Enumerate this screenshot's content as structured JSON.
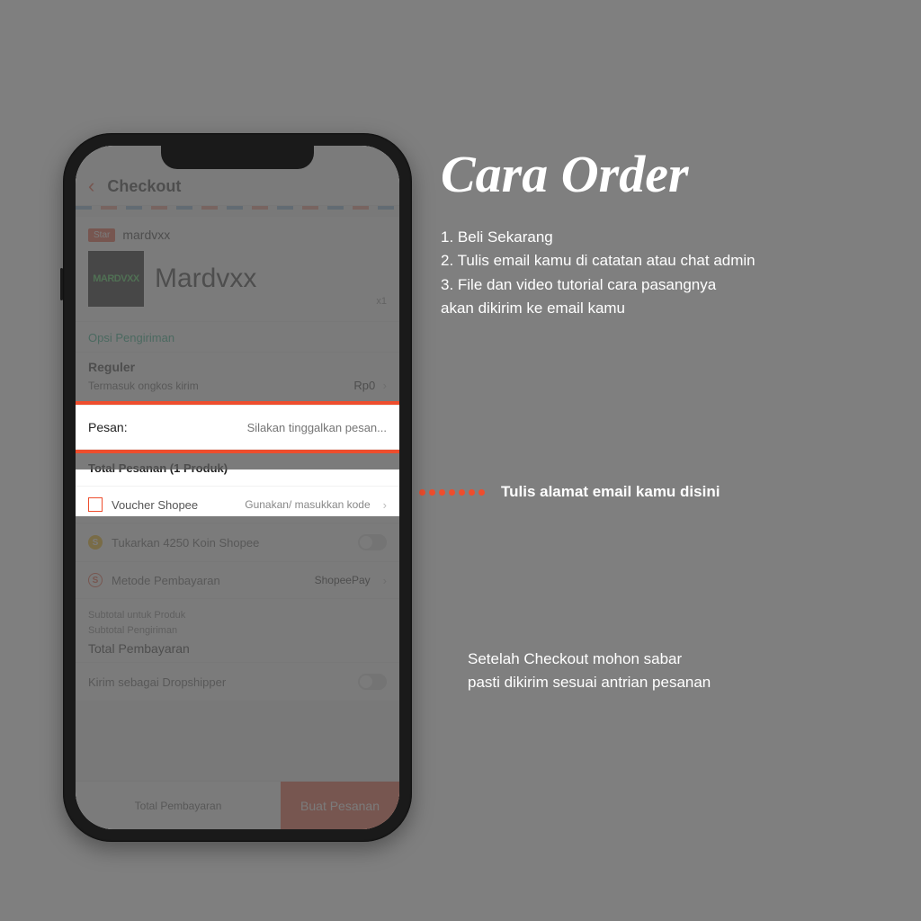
{
  "right": {
    "headline": "Cara Order",
    "steps": [
      "1.  Beli Sekarang",
      "2. Tulis email kamu di catatan atau chat admin",
      "3. File dan video tutorial cara pasangnya",
      "akan dikirim ke email kamu"
    ],
    "callout": "Tulis alamat email kamu disini",
    "footer1": "Setelah Checkout mohon sabar",
    "footer2": "pasti dikirim sesuai antrian pesanan"
  },
  "app": {
    "title": "Checkout",
    "seller_badge": "Star",
    "seller_name": "mardvxx",
    "product_name": "Mardvxx",
    "thumb_text": "MARDVXX",
    "qty": "x1",
    "opsi": "Opsi Pengiriman",
    "ship_label": "Reguler",
    "ship_sub": "Termasuk ongkos kirim",
    "ship_price": "Rp0",
    "msg_label": "Pesan:",
    "msg_placeholder": "Silakan tinggalkan pesan...",
    "total_line": "Total Pesanan (1 Produk)",
    "voucher": {
      "label": "Voucher Shopee",
      "right": "Gunakan/ masukkan kode"
    },
    "coin": {
      "label": "Tukarkan 4250 Koin Shopee",
      "coin_letter": "S"
    },
    "pay": {
      "label": "Metode Pembayaran",
      "value": "ShopeePay",
      "icon_letter": "S"
    },
    "sub_product": "Subtotal untuk Produk",
    "sub_ship": "Subtotal Pengiriman",
    "grand": "Total Pembayaran",
    "dropship": "Kirim sebagai Dropshipper",
    "bottom_total": "Total Pembayaran",
    "order_btn": "Buat Pesanan"
  }
}
